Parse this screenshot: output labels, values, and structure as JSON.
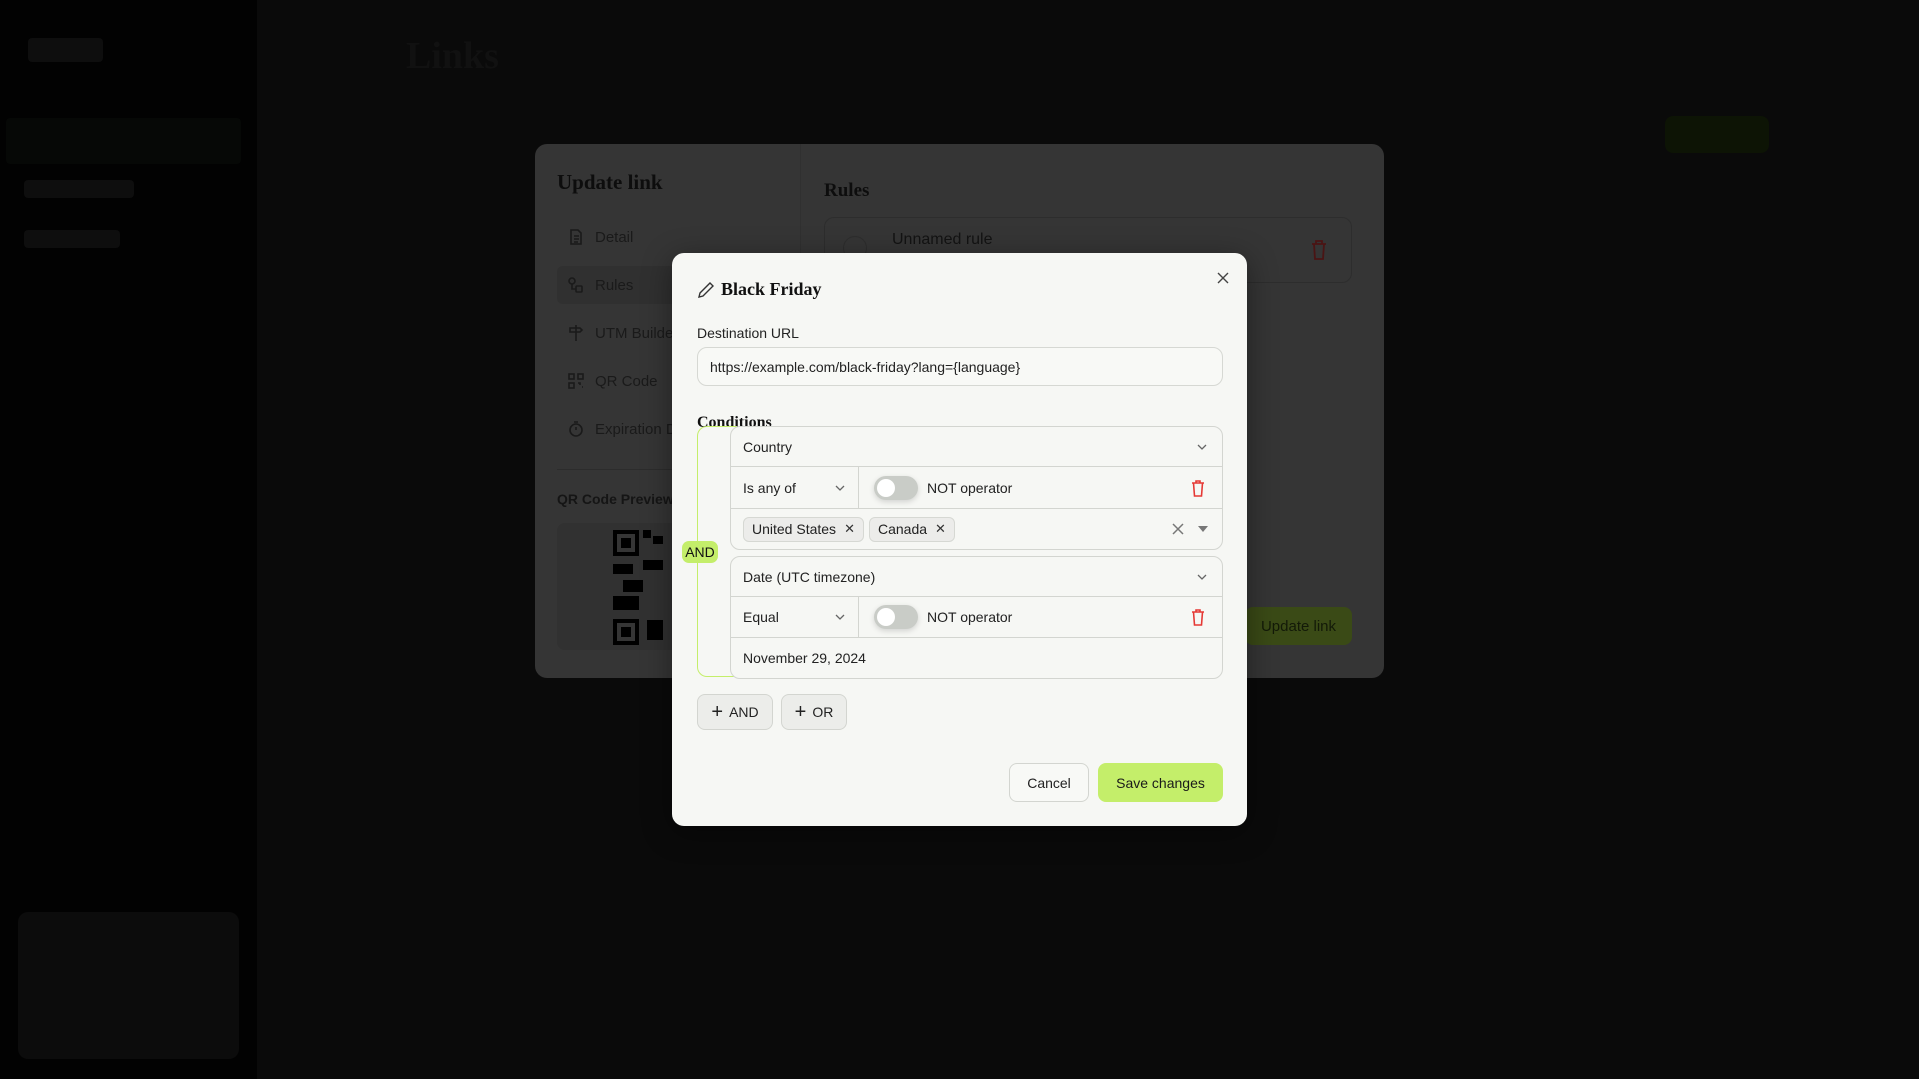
{
  "background": {
    "page_title": "Links",
    "update_link_panel": {
      "title": "Update link",
      "nav": [
        {
          "label": "Detail",
          "icon": "document-icon"
        },
        {
          "label": "Rules",
          "icon": "rules-icon",
          "active": true
        },
        {
          "label": "UTM Builder",
          "icon": "signpost-icon"
        },
        {
          "label": "QR Code",
          "icon": "qr-icon"
        },
        {
          "label": "Expiration D",
          "icon": "timer-icon"
        }
      ],
      "qr_preview_label": "QR Code Preview",
      "rules_title": "Rules",
      "rule_name": "Unnamed rule",
      "update_button": "Update link"
    }
  },
  "modal": {
    "title": "Black Friday",
    "destination_label": "Destination URL",
    "destination_value": "https://example.com/black-friday?lang={language}",
    "conditions_title": "Conditions",
    "join_operator": "AND",
    "conditions": [
      {
        "field": "Country",
        "operator": "Is any of",
        "not_label": "NOT operator",
        "not_enabled": false,
        "values": [
          "United States",
          "Canada"
        ]
      },
      {
        "field": "Date (UTC timezone)",
        "operator": "Equal",
        "not_label": "NOT operator",
        "not_enabled": false,
        "value": "November 29, 2024"
      }
    ],
    "add_and": "AND",
    "add_or": "OR",
    "cancel": "Cancel",
    "save": "Save changes"
  },
  "colors": {
    "accent": "#c4ee6a",
    "danger": "#e53935",
    "modal_bg": "#f6f7f4"
  }
}
